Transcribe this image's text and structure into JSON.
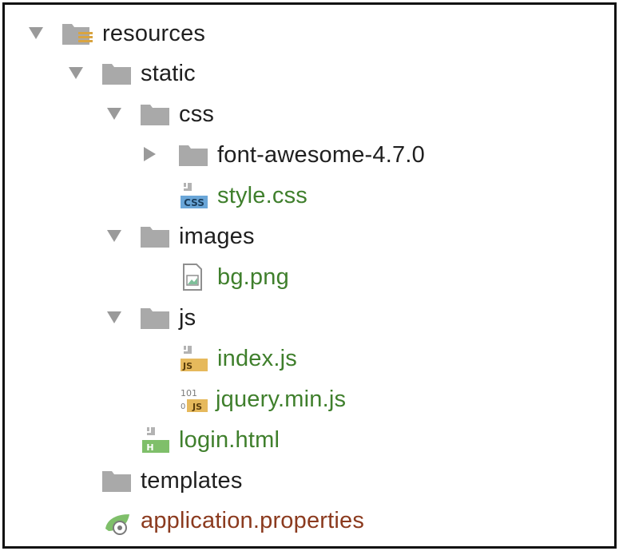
{
  "tree": {
    "resources": {
      "label": "resources",
      "expanded": true,
      "icon": "resources-folder-icon"
    },
    "static": {
      "label": "static",
      "expanded": true,
      "icon": "folder-icon"
    },
    "css": {
      "label": "css",
      "expanded": true,
      "icon": "folder-icon"
    },
    "font_awesome": {
      "label": "font-awesome-4.7.0",
      "expanded": false,
      "icon": "folder-icon"
    },
    "style_css": {
      "label": "style.css",
      "icon": "css-file-icon",
      "badge": "CSS"
    },
    "images": {
      "label": "images",
      "expanded": true,
      "icon": "folder-icon"
    },
    "bg_png": {
      "label": "bg.png",
      "icon": "image-file-icon"
    },
    "js": {
      "label": "js",
      "expanded": true,
      "icon": "folder-icon"
    },
    "index_js": {
      "label": "index.js",
      "icon": "js-file-icon",
      "badge": "JS"
    },
    "jquery_min_js": {
      "label": "jquery.min.js",
      "icon": "minified-js-file-icon",
      "badge": "JS",
      "binary_text": "101"
    },
    "login_html": {
      "label": "login.html",
      "icon": "html-file-icon",
      "badge": "H"
    },
    "templates": {
      "label": "templates",
      "expanded": false,
      "icon": "folder-icon"
    },
    "application_properties": {
      "label": "application.properties",
      "icon": "properties-file-icon"
    }
  },
  "colors": {
    "folder": "#a9a9a9",
    "text": "#1f1f1f",
    "modified_green": "#3f7f2c",
    "properties_brown": "#8b3a1e",
    "css_badge": "#6aa6d8",
    "js_badge": "#e6b95c",
    "html_badge": "#7fbf6a"
  }
}
